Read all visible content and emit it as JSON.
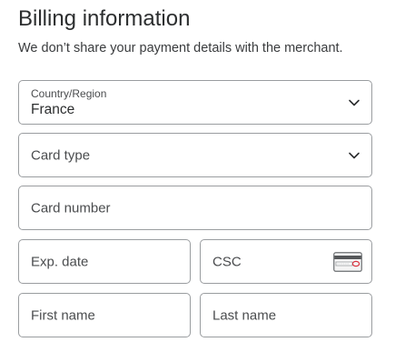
{
  "header": {
    "title": "Billing information",
    "subtitle": "We don’t share your payment details with the merchant."
  },
  "form": {
    "country": {
      "label": "Country/Region",
      "value": "France",
      "icon": "chevron-down-icon"
    },
    "card_type": {
      "placeholder": "Card type",
      "icon": "chevron-down-icon"
    },
    "card_number": {
      "placeholder": "Card number"
    },
    "exp_date": {
      "placeholder": "Exp. date"
    },
    "csc": {
      "placeholder": "CSC",
      "icon": "card-security-code-icon"
    },
    "first_name": {
      "placeholder": "First name"
    },
    "last_name": {
      "placeholder": "Last name"
    }
  },
  "colors": {
    "border": "#9a9da0",
    "text": "#2c2e2f",
    "accent": "#d9333f"
  }
}
